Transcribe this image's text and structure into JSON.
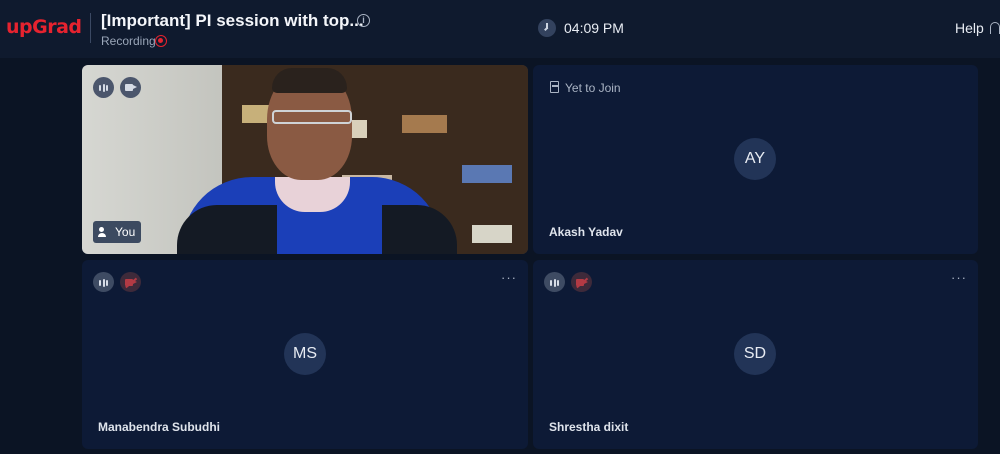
{
  "header": {
    "logo": "upGrad",
    "title": "[Important] PI session with top...",
    "info_icon": "info-icon",
    "recording_label": "Recording",
    "time": "04:09 PM",
    "help_label": "Help"
  },
  "tiles": [
    {
      "type": "video",
      "label": "You"
    },
    {
      "type": "avatar",
      "status": "Yet to Join",
      "initials": "AY",
      "name": "Akash Yadav"
    },
    {
      "type": "avatar",
      "initials": "MS",
      "name": "Manabendra Subudhi",
      "more": "···"
    },
    {
      "type": "avatar",
      "initials": "SD",
      "name": "Shrestha dixit",
      "more": "···"
    }
  ],
  "colors": {
    "brand": "#e6232f",
    "background": "#0b1424",
    "tile": "#0d1a36"
  }
}
